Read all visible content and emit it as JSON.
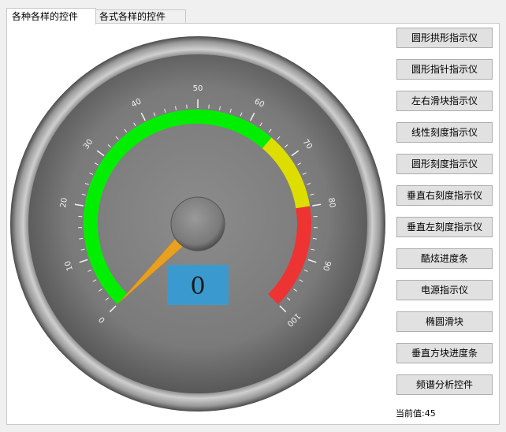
{
  "tabs": [
    {
      "label": "各种各样的控件",
      "active": true
    },
    {
      "label": "各式各样的控件",
      "active": false
    }
  ],
  "gauge": {
    "min": 0,
    "max": 100,
    "current_value": 0,
    "display_text": "0",
    "tick_labels": [
      "0",
      "10",
      "20",
      "30",
      "40",
      "50",
      "60",
      "70",
      "80",
      "90",
      "100"
    ],
    "ranges": [
      {
        "from": 0,
        "to": 65,
        "color": "#00ee00"
      },
      {
        "from": 65,
        "to": 80,
        "color": "#dddd00"
      },
      {
        "from": 80,
        "to": 100,
        "color": "#ee3333"
      }
    ],
    "pointer_color": "#e8a020",
    "value_box_color": "#3a9ad0"
  },
  "buttons": [
    "圆形拱形指示仪",
    "圆形指针指示仪",
    "左右滑块指示仪",
    "线性刻度指示仪",
    "圆形刻度指示仪",
    "垂直右刻度指示仪",
    "垂直左刻度指示仪",
    "酷炫进度条",
    "电源指示仪",
    "椭圆滑块",
    "垂直方块进度条",
    "频谱分析控件"
  ],
  "status": {
    "label": "当前值:",
    "value": "45"
  }
}
